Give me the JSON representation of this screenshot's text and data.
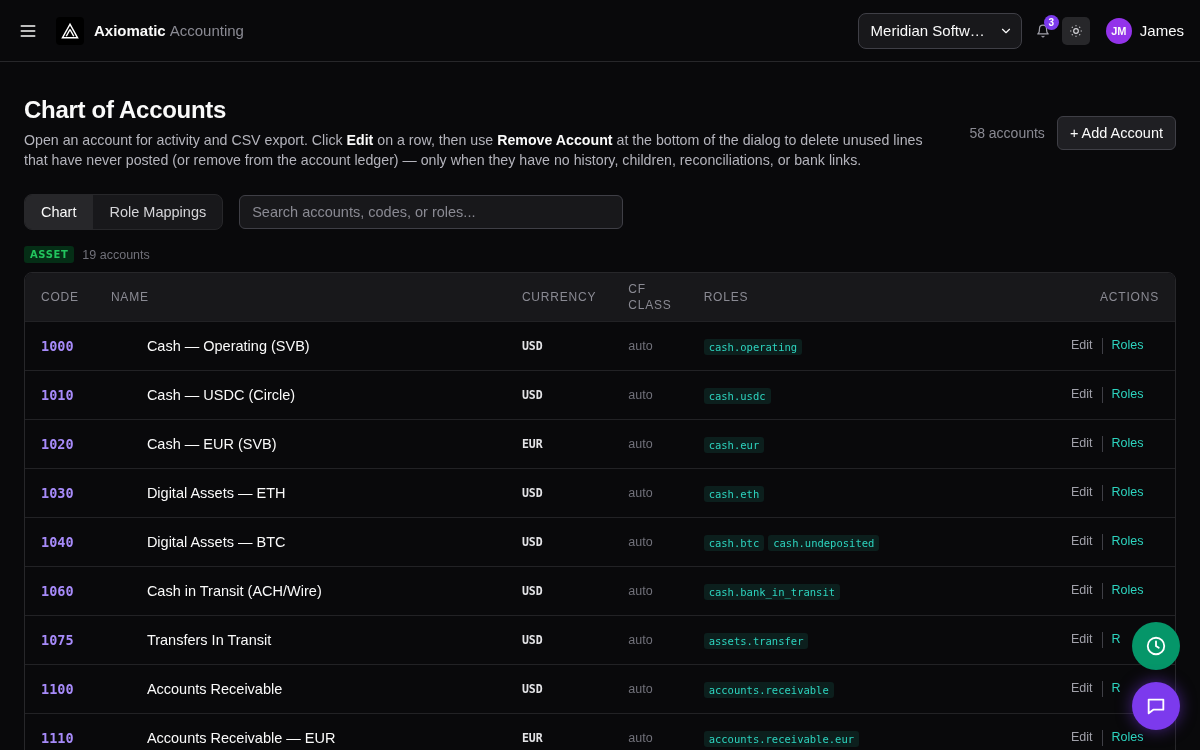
{
  "header": {
    "brand": "Axiomatic",
    "brand_suffix": "Accounting",
    "org_select": "Meridian Softw…",
    "notification_count": "3",
    "user_initials": "JM",
    "user_name": "James"
  },
  "page": {
    "title": "Chart of Accounts",
    "description": "Open an account for activity and CSV export. Click **Edit** on a row, then use **Remove Account** at the bottom of the dialog to delete unused lines that have never posted (or remove from the account ledger) — only when they have no history, children, reconciliations, or bank links.",
    "account_count": "58 accounts",
    "add_button": "+ Add Account"
  },
  "tabs": [
    {
      "label": "Chart",
      "selected": true
    },
    {
      "label": "Role Mappings",
      "selected": false
    }
  ],
  "search": {
    "placeholder": "Search accounts, codes, or roles..."
  },
  "group": {
    "type": "ASSET",
    "count": "19 accounts"
  },
  "table": {
    "columns": [
      "CODE",
      "NAME",
      "CURRENCY",
      "CF CLASS",
      "ROLES",
      "ACTIONS"
    ],
    "rows": [
      {
        "code": "1000",
        "name": "Cash — Operating (SVB)",
        "currency": "USD",
        "cf_class": "auto",
        "roles": [
          "cash.operating"
        ],
        "actions": [
          "Edit",
          "Roles"
        ]
      },
      {
        "code": "1010",
        "name": "Cash — USDC (Circle)",
        "currency": "USD",
        "cf_class": "auto",
        "roles": [
          "cash.usdc"
        ],
        "actions": [
          "Edit",
          "Roles"
        ]
      },
      {
        "code": "1020",
        "name": "Cash — EUR (SVB)",
        "currency": "EUR",
        "cf_class": "auto",
        "roles": [
          "cash.eur"
        ],
        "actions": [
          "Edit",
          "Roles"
        ]
      },
      {
        "code": "1030",
        "name": "Digital Assets — ETH",
        "currency": "USD",
        "cf_class": "auto",
        "roles": [
          "cash.eth"
        ],
        "actions": [
          "Edit",
          "Roles"
        ]
      },
      {
        "code": "1040",
        "name": "Digital Assets — BTC",
        "currency": "USD",
        "cf_class": "auto",
        "roles": [
          "cash.btc",
          "cash.undeposited"
        ],
        "actions": [
          "Edit",
          "Roles"
        ]
      },
      {
        "code": "1060",
        "name": "Cash in Transit (ACH/Wire)",
        "currency": "USD",
        "cf_class": "auto",
        "roles": [
          "cash.bank_in_transit"
        ],
        "actions": [
          "Edit",
          "Roles"
        ]
      },
      {
        "code": "1075",
        "name": "Transfers In Transit",
        "currency": "USD",
        "cf_class": "auto",
        "roles": [
          "assets.transfer"
        ],
        "actions": [
          "Edit",
          "R"
        ]
      },
      {
        "code": "1100",
        "name": "Accounts Receivable",
        "currency": "USD",
        "cf_class": "auto",
        "roles": [
          "accounts.receivable"
        ],
        "actions": [
          "Edit",
          "R"
        ]
      },
      {
        "code": "1110",
        "name": "Accounts Receivable — EUR",
        "currency": "EUR",
        "cf_class": "auto",
        "roles": [
          "accounts.receivable.eur"
        ],
        "actions": [
          "Edit",
          "Roles"
        ]
      }
    ]
  }
}
